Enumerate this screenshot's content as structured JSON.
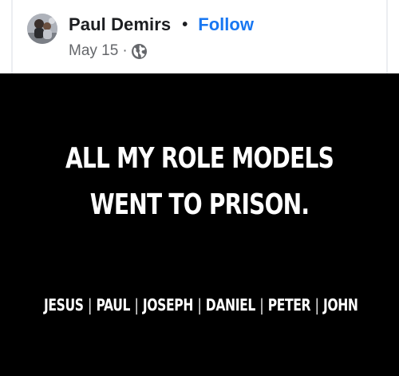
{
  "post": {
    "author_name": "Paul Demirs",
    "separator": "•",
    "follow_label": "Follow",
    "date": "May 15",
    "meta_separator": "·",
    "audience_icon": "globe-icon",
    "accent_color": "#1877f2"
  },
  "image": {
    "background_color": "#000000",
    "headline_line1": "ALL MY ROLE MODELS",
    "headline_line2": "WENT TO PRISON.",
    "names": [
      "JESUS",
      "PAUL",
      "JOSEPH",
      "DANIEL",
      "PETER",
      "JOHN"
    ],
    "name_separator": "|"
  }
}
